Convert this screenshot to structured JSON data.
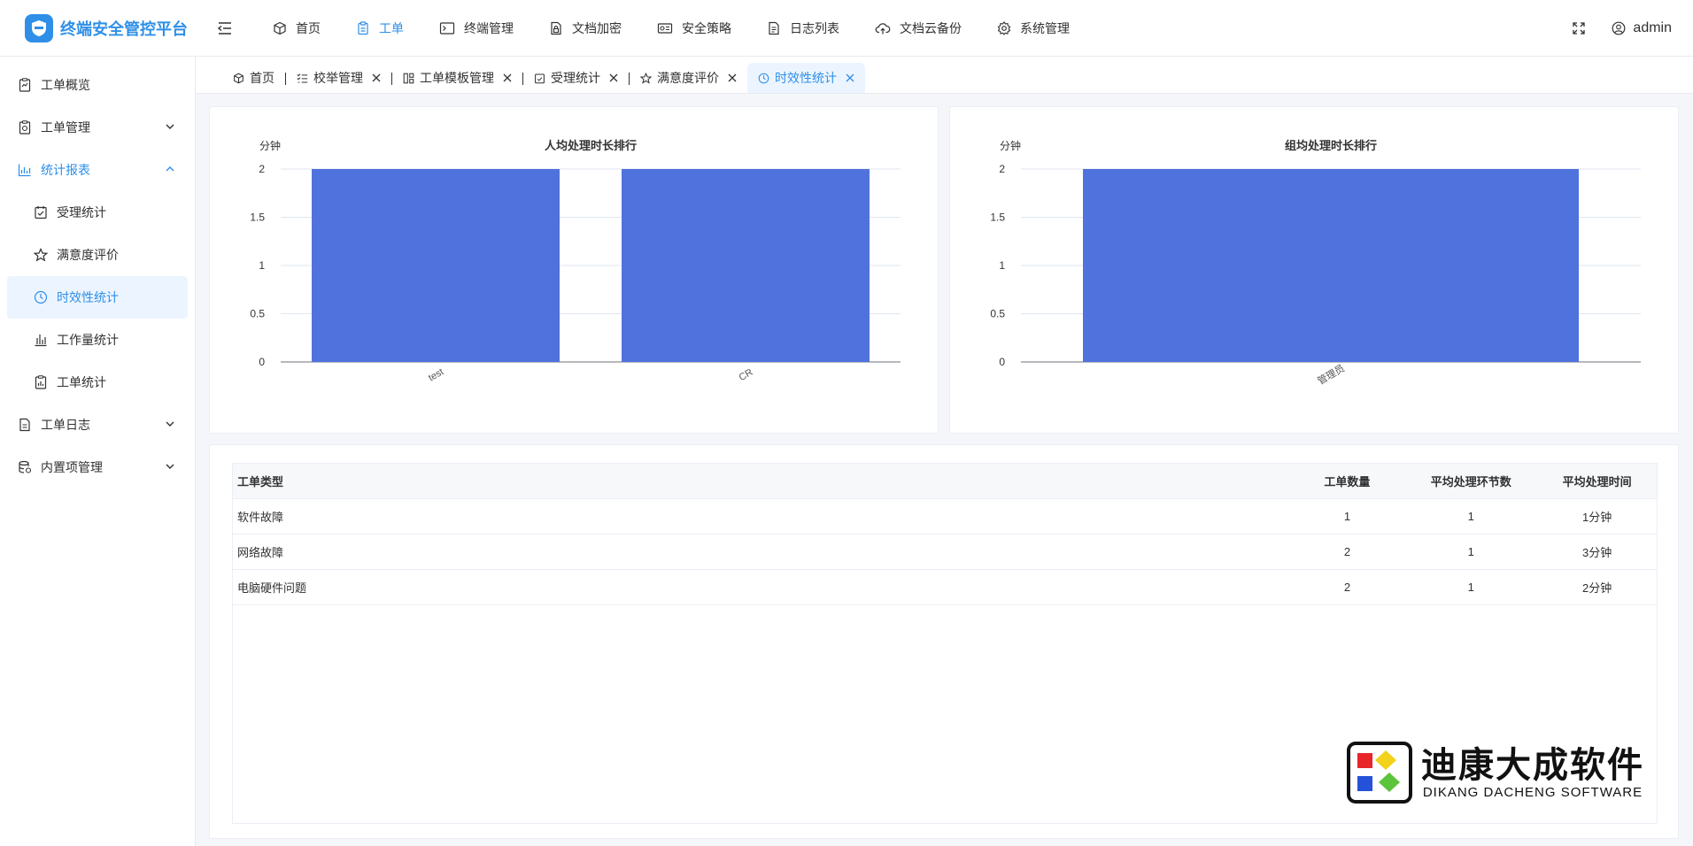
{
  "app": {
    "title": "终端安全管控平台"
  },
  "topnav": [
    {
      "label": "首页",
      "icon": "cube-icon"
    },
    {
      "label": "工单",
      "icon": "clipboard-icon",
      "active": true
    },
    {
      "label": "终端管理",
      "icon": "terminal-icon"
    },
    {
      "label": "文档加密",
      "icon": "doc-lock-icon"
    },
    {
      "label": "安全策略",
      "icon": "id-card-icon"
    },
    {
      "label": "日志列表",
      "icon": "doc-list-icon"
    },
    {
      "label": "文档云备份",
      "icon": "cloud-upload-icon"
    },
    {
      "label": "系统管理",
      "icon": "gear-icon"
    }
  ],
  "user": {
    "name": "admin"
  },
  "sidebar": {
    "items": [
      {
        "label": "工单概览"
      },
      {
        "label": "工单管理"
      },
      {
        "label": "统计报表"
      },
      {
        "label": "受理统计"
      },
      {
        "label": "满意度评价"
      },
      {
        "label": "时效性统计"
      },
      {
        "label": "工作量统计"
      },
      {
        "label": "工单统计"
      },
      {
        "label": "工单日志"
      },
      {
        "label": "内置项管理"
      }
    ]
  },
  "tabs": [
    {
      "label": "首页"
    },
    {
      "label": "校举管理"
    },
    {
      "label": "工单模板管理"
    },
    {
      "label": "受理统计"
    },
    {
      "label": "满意度评价"
    },
    {
      "label": "时效性统计"
    }
  ],
  "colors": {
    "accent": "#2f8fe8",
    "bar": "#5072dd"
  },
  "chart_data": [
    {
      "type": "bar",
      "title": "人均处理时长排行",
      "ylabel": "分钟",
      "categories": [
        "test",
        "CR"
      ],
      "values": [
        2,
        2
      ],
      "ylim": [
        0,
        2
      ],
      "yticks": [
        "0",
        "0.5",
        "1",
        "1.5",
        "2"
      ],
      "grid": true
    },
    {
      "type": "bar",
      "title": "组均处理时长排行",
      "ylabel": "分钟",
      "categories": [
        "管理员"
      ],
      "values": [
        2
      ],
      "ylim": [
        0,
        2
      ],
      "yticks": [
        "0",
        "0.5",
        "1",
        "1.5",
        "2"
      ],
      "grid": true
    }
  ],
  "table": {
    "headers": [
      "工单类型",
      "工单数量",
      "平均处理环节数",
      "平均处理时间"
    ],
    "rows": [
      [
        "软件故障",
        "1",
        "1",
        "1分钟"
      ],
      [
        "网络故障",
        "2",
        "1",
        "3分钟"
      ],
      [
        "电脑硬件问题",
        "2",
        "1",
        "2分钟"
      ]
    ]
  },
  "watermark": {
    "cn": "迪康大成软件",
    "en": "DIKANG DACHENG SOFTWARE"
  }
}
